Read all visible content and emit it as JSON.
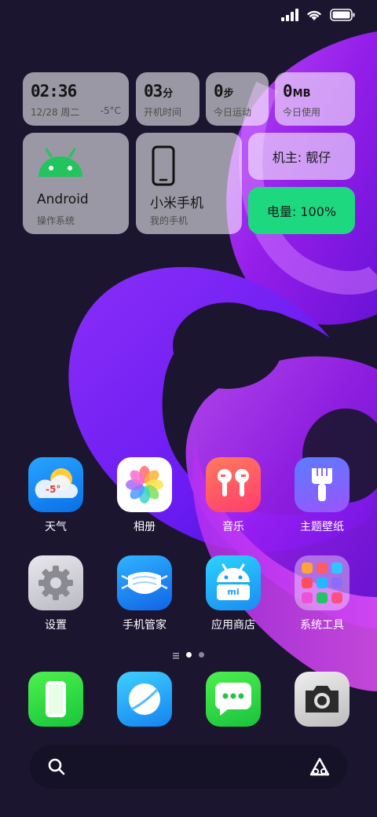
{
  "status_bar": {
    "icons": [
      "cellular-signal-icon",
      "wifi-icon",
      "battery-icon"
    ]
  },
  "widgets": {
    "clock": {
      "time": "02:36",
      "date": "12/28 周二",
      "temperature": "-5°C"
    },
    "uptime": {
      "value": "03",
      "unit": "分",
      "label": "开机时间"
    },
    "steps": {
      "value": "0",
      "unit": "步",
      "label": "今日运动"
    },
    "data_usage": {
      "value": "0",
      "unit": "MB",
      "label": "今日使用"
    },
    "os": {
      "title": "Android",
      "subtitle": "操作系统",
      "icon": "android-icon"
    },
    "device": {
      "title": "小米手机",
      "subtitle": "我的手机",
      "icon": "phone-outline-icon"
    },
    "owner": {
      "text": "机主: 靓仔"
    },
    "battery": {
      "text": "电量: 100%",
      "color": "#1ed880"
    }
  },
  "apps": [
    {
      "label": "天气",
      "icon": "weather-icon",
      "badge": "-5°"
    },
    {
      "label": "相册",
      "icon": "gallery-flower-icon"
    },
    {
      "label": "音乐",
      "icon": "earbuds-icon"
    },
    {
      "label": "主题壁纸",
      "icon": "paintbrush-icon"
    },
    {
      "label": "设置",
      "icon": "gear-icon"
    },
    {
      "label": "手机管家",
      "icon": "mask-icon"
    },
    {
      "label": "应用商店",
      "icon": "android-store-icon",
      "badge": "mi"
    },
    {
      "label": "系统工具",
      "icon": "folder-icon"
    }
  ],
  "page_indicator": {
    "pages": 2,
    "current": 1
  },
  "dock": [
    {
      "name": "phone",
      "icon": "phone-icon"
    },
    {
      "name": "browser",
      "icon": "browser-icon"
    },
    {
      "name": "messages",
      "icon": "messages-icon"
    },
    {
      "name": "camera",
      "icon": "camera-icon"
    }
  ],
  "search": {
    "left_icon": "search-icon",
    "right_icon": "assistant-icon"
  },
  "colors": {
    "background": "#1b1530",
    "wallpaper_accent": "#a81ff0",
    "battery_widget": "#1ed880"
  }
}
